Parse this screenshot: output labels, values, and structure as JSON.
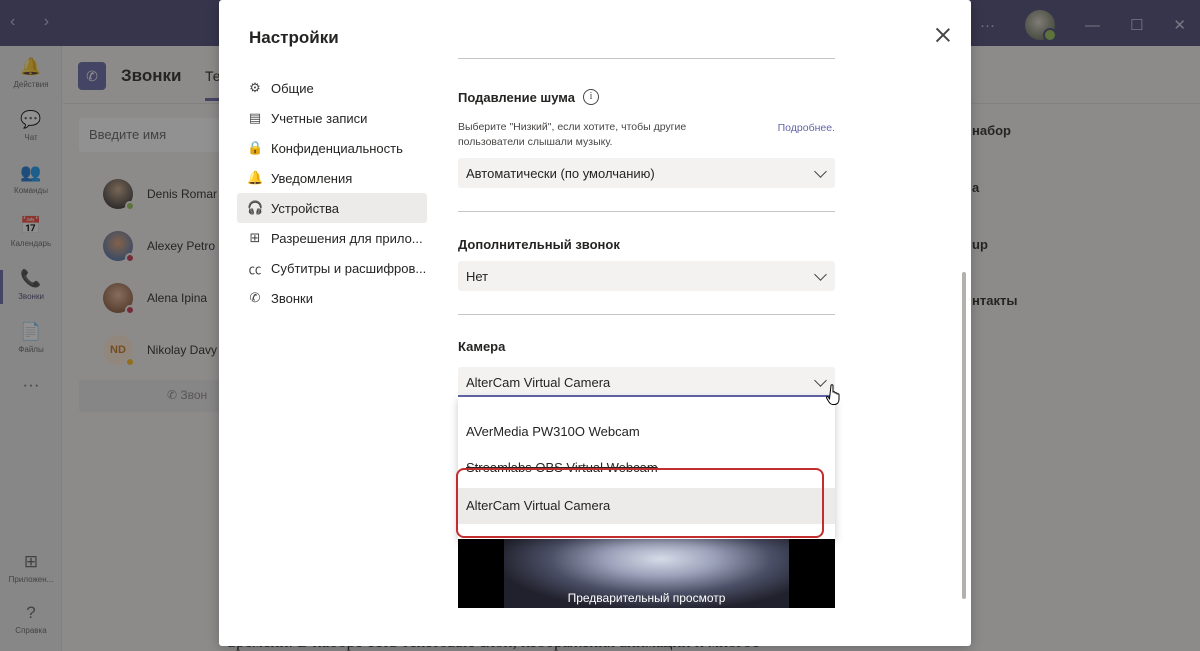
{
  "app": {
    "rail": [
      {
        "icon": "bell-icon",
        "glyph": "🔔",
        "label": "Действия"
      },
      {
        "icon": "chat-icon",
        "glyph": "💬",
        "label": "Чат"
      },
      {
        "icon": "teams-icon",
        "glyph": "👥",
        "label": "Команды"
      },
      {
        "icon": "calendar-icon",
        "glyph": "📅",
        "label": "Календарь"
      },
      {
        "icon": "phone-icon",
        "glyph": "📞",
        "label": "Звонки"
      },
      {
        "icon": "file-icon",
        "glyph": "📄",
        "label": "Файлы"
      },
      {
        "icon": "more-icon",
        "glyph": "···",
        "label": ""
      },
      {
        "icon": "apps-icon",
        "glyph": "⊞",
        "label": "Приложен..."
      },
      {
        "icon": "help-icon",
        "glyph": "?",
        "label": "Справка"
      }
    ],
    "calls_title": "Звонки",
    "calls_tab": "Те",
    "name_placeholder": "Введите имя",
    "contacts": [
      {
        "name": "Denis Romar"
      },
      {
        "name": "Alexey Petro"
      },
      {
        "name": "Alena Ipina"
      },
      {
        "name": "Nikolay Davy",
        "initials": "ND"
      }
    ],
    "call_button": "Звон",
    "right_items": [
      "набор",
      "а",
      "up",
      "нтакты"
    ]
  },
  "article_text": "времени. В наборе есть текстовые слои, изображения анимации и многое",
  "dialog": {
    "title": "Настройки",
    "nav": [
      {
        "label": "Общие",
        "icon": "gear-icon",
        "glyph": "⚙"
      },
      {
        "label": "Учетные записи",
        "icon": "id-card-icon",
        "glyph": "▤"
      },
      {
        "label": "Конфиденциальность",
        "icon": "lock-icon",
        "glyph": "🔒"
      },
      {
        "label": "Уведомления",
        "icon": "bell-icon",
        "glyph": "🔔"
      },
      {
        "label": "Устройства",
        "icon": "headset-icon",
        "glyph": "🎧"
      },
      {
        "label": "Разрешения для прило...",
        "icon": "apps-icon",
        "glyph": "⊞"
      },
      {
        "label": "Субтитры и расшифров...",
        "icon": "cc-icon",
        "glyph": "㏄"
      },
      {
        "label": "Звонки",
        "icon": "phone-icon",
        "glyph": "✆"
      }
    ],
    "active_nav": "Устройства",
    "noise": {
      "heading": "Подавление шума",
      "description": "Выберите \"Низкий\", если хотите, чтобы другие пользователи слышали музыку.",
      "more": "Подробнее.",
      "value": "Автоматически (по умолчанию)"
    },
    "secondary_ringer": {
      "heading": "Дополнительный звонок",
      "value": "Нет"
    },
    "camera": {
      "heading": "Камера",
      "value": "AlterCam Virtual Camera",
      "options": [
        "AVerMedia PW310O Webcam",
        "Streamlabs OBS Virtual Webcam",
        "AlterCam Virtual Camera"
      ],
      "selected": "AlterCam Virtual Camera",
      "preview_label": "Предварительный просмотр"
    }
  },
  "colors": {
    "titlebar": "#464775",
    "accent": "#6264a7",
    "highlight_box": "#c22d2d"
  }
}
